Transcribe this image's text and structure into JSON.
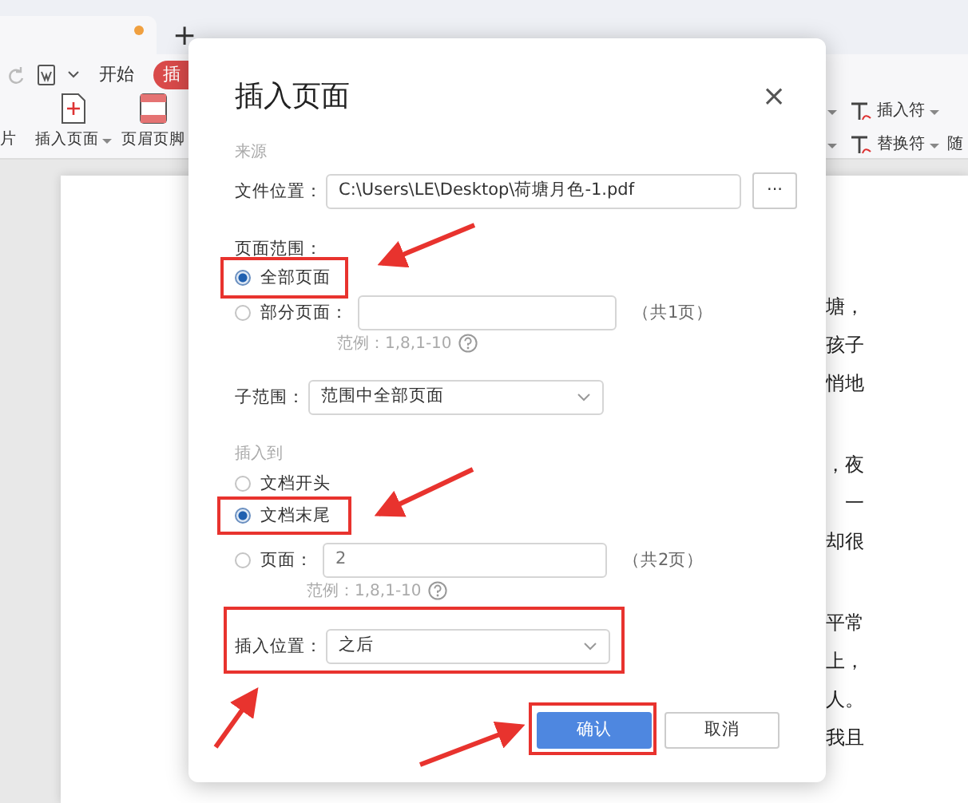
{
  "tab_bar": {
    "tab_modified": true,
    "new_tab": "+"
  },
  "menu": [
    {
      "label": "开始",
      "selected": false
    },
    {
      "label": "插",
      "selected": true
    }
  ],
  "ribbon": {
    "cut_left": "片",
    "left_items": [
      {
        "kind": "insert-page",
        "label": "插入页面",
        "dropdown": true
      },
      {
        "kind": "header-footer",
        "label": "页眉页脚",
        "dropdown": false
      }
    ],
    "right_rows": [
      {
        "label": "插入符"
      },
      {
        "label": "替换符"
      }
    ],
    "cut_right": "随"
  },
  "document": {
    "paragraphs": [
      [
        "塘，",
        "孩子",
        "悄地"
      ],
      [
        "，夜",
        "一",
        "却很"
      ],
      [
        "平常",
        "上，",
        "人。",
        "我且"
      ]
    ]
  },
  "dialog": {
    "title": "插入页面",
    "close": "×",
    "source_label": "来源",
    "file_label": "文件位置：",
    "file_path": "C:\\Users\\LE\\Desktop\\荷塘月色-1.pdf",
    "browse": "···",
    "range_label": "页面范围：",
    "range_options": [
      {
        "label": "全部页面",
        "selected": true
      },
      {
        "label": "部分页面：",
        "selected": false,
        "kind": "input",
        "total": "（共1页）",
        "hint": "范例：1,8,1-10"
      }
    ],
    "subrange_label": "子范围：",
    "subrange_value": "范围中全部页面",
    "insert_label": "插入到",
    "insert_options": [
      {
        "label": "文档开头",
        "selected": false
      },
      {
        "label": "文档末尾",
        "selected": true
      },
      {
        "label": "页面：",
        "selected": false,
        "kind": "input",
        "value": "2",
        "total": "（共2页）",
        "hint": "范例：1,8,1-10"
      }
    ],
    "position_label": "插入位置：",
    "position_value": "之后",
    "buttons": [
      {
        "label": "确认",
        "kind": "primary"
      },
      {
        "label": "取消",
        "kind": "secondary"
      }
    ]
  }
}
